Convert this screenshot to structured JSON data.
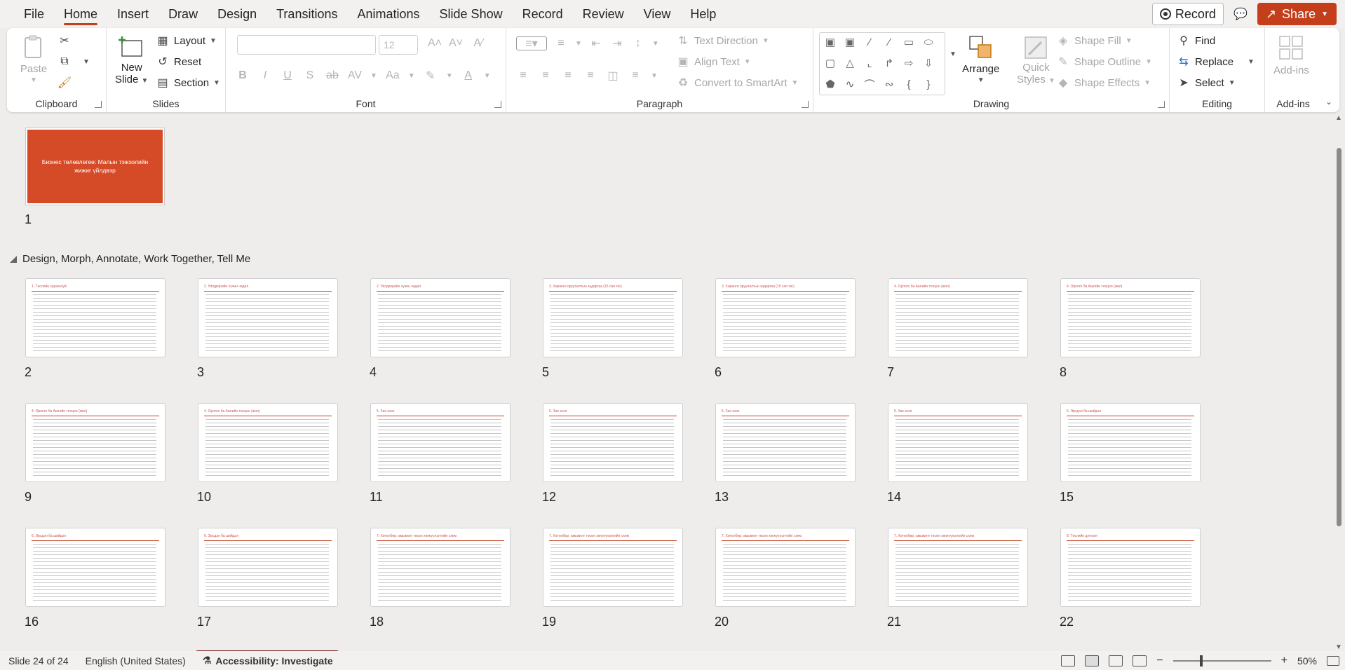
{
  "menubar": {
    "tabs": [
      "File",
      "Home",
      "Insert",
      "Draw",
      "Design",
      "Transitions",
      "Animations",
      "Slide Show",
      "Record",
      "Review",
      "View",
      "Help"
    ],
    "active_tab": "Home",
    "record_label": "Record",
    "share_label": "Share"
  },
  "ribbon": {
    "clipboard": {
      "label": "Clipboard",
      "paste": "Paste"
    },
    "slides": {
      "label": "Slides",
      "new_slide": "New",
      "new_slide2": "Slide",
      "layout": "Layout",
      "reset": "Reset",
      "section": "Section"
    },
    "font": {
      "label": "Font",
      "size": "12"
    },
    "paragraph": {
      "label": "Paragraph",
      "text_direction": "Text Direction",
      "align_text": "Align Text",
      "convert_smartart": "Convert to SmartArt"
    },
    "drawing": {
      "label": "Drawing",
      "arrange": "Arrange",
      "quick_styles": "Quick",
      "quick_styles2": "Styles",
      "shape_fill": "Shape Fill",
      "shape_outline": "Shape Outline",
      "shape_effects": "Shape Effects"
    },
    "editing": {
      "label": "Editing",
      "find": "Find",
      "replace": "Replace",
      "select": "Select"
    },
    "addins": {
      "label": "Add-ins",
      "addins": "Add-ins"
    }
  },
  "sorter": {
    "title_slide_text": "Бизнес төлөвлөгөө: Малын тэжээлийн жижиг үйлдвэр",
    "section_name": "Design, Morph, Annotate, Work Together, Tell Me",
    "slides": [
      {
        "num": "1"
      },
      {
        "num": "2",
        "title": "1. Төслийн хураангуй"
      },
      {
        "num": "3",
        "title": "2. Үйлдвэрийн хүчин чадал"
      },
      {
        "num": "4",
        "title": "2. Үйлдвэрийн хүчин чадал"
      },
      {
        "num": "5",
        "title": "3. Хөрөнгө оруулалтын задаргаа (15 сая төг)"
      },
      {
        "num": "6",
        "title": "3. Хөрөнгө оруулалтын задаргаа (15 сая төг)"
      },
      {
        "num": "7",
        "title": "4. Орлого ба Ашгийн тооцоо (жил)"
      },
      {
        "num": "8",
        "title": "4. Орлого ба Ашгийн тооцоо (жил)"
      },
      {
        "num": "9",
        "title": "4. Орлого ба Ашгийн тооцоо (жил)"
      },
      {
        "num": "10",
        "title": "4. Орлого ба Ашгийн тооцоо (жил)"
      },
      {
        "num": "11",
        "title": "5. Зах зээл"
      },
      {
        "num": "12",
        "title": "5. Зах зээл"
      },
      {
        "num": "13",
        "title": "5. Зах зээл"
      },
      {
        "num": "14",
        "title": "5. Зах зээл"
      },
      {
        "num": "15",
        "title": "6. Эрсдэл ба шийдэл"
      },
      {
        "num": "16",
        "title": "6. Эрсдэл ба шийдэл"
      },
      {
        "num": "17",
        "title": "6. Эрсдэл ба шийдэл"
      },
      {
        "num": "18",
        "title": "7. Хөтөлбөр: амьжилт төсөл хөгжүүлэлтийн схем"
      },
      {
        "num": "19",
        "title": "7. Хөтөлбөр: амьжилт төсөл хөгжүүлэлтийн схем"
      },
      {
        "num": "20",
        "title": "7. Хөтөлбөр: амьжилт төсөл хөгжүүлэлтийн схем"
      },
      {
        "num": "21",
        "title": "7. Хөтөлбөр: амьжилт төсөл хөгжүүлэлтийн схем"
      },
      {
        "num": "22",
        "title": "8. Төслийн дүгнэлт"
      }
    ]
  },
  "statusbar": {
    "slide_count": "Slide 24 of 24",
    "language": "English (United States)",
    "accessibility": "Accessibility: Investigate",
    "zoom": "50%"
  }
}
